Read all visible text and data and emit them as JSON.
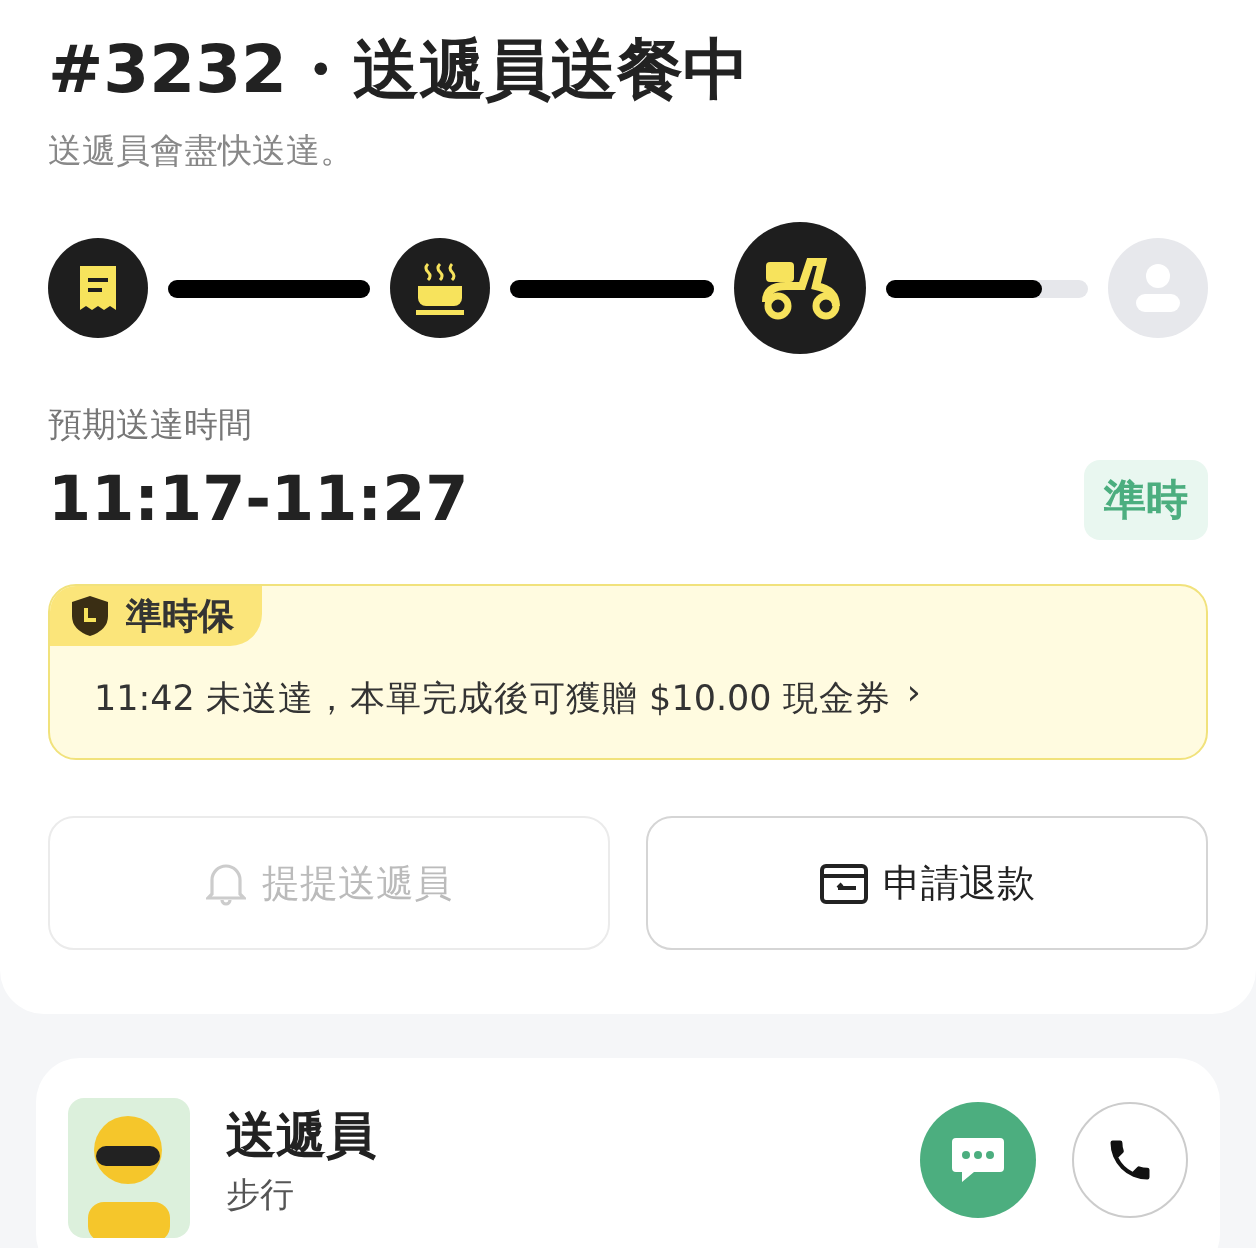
{
  "header": {
    "title": "#3232・送遞員送餐中",
    "subtitle": "送遞員會盡快送達。"
  },
  "progress": {
    "steps": [
      {
        "kind": "receipt",
        "reached": true,
        "current": false
      },
      {
        "kind": "food",
        "reached": true,
        "current": false
      },
      {
        "kind": "scooter",
        "reached": true,
        "current": true
      },
      {
        "kind": "customer",
        "reached": false,
        "current": false
      }
    ],
    "connectors": [
      {
        "level": 1
      },
      {
        "level": 1
      },
      {
        "level": 0.77
      }
    ]
  },
  "eta": {
    "label": "預期送達時間",
    "time": "11:17-11:27",
    "badge": "準時"
  },
  "guarantee": {
    "tag": "準時保",
    "message": "11:42 未送達，本單完成後可獲贈 $10.00 現金券",
    "chevron": "›"
  },
  "actions": [
    {
      "kind": "bell",
      "label": "提提送遞員",
      "disabled": true
    },
    {
      "kind": "refund",
      "label": "申請退款",
      "disabled": false
    }
  ],
  "courier": {
    "name": "送遞員",
    "mode": "步行"
  }
}
